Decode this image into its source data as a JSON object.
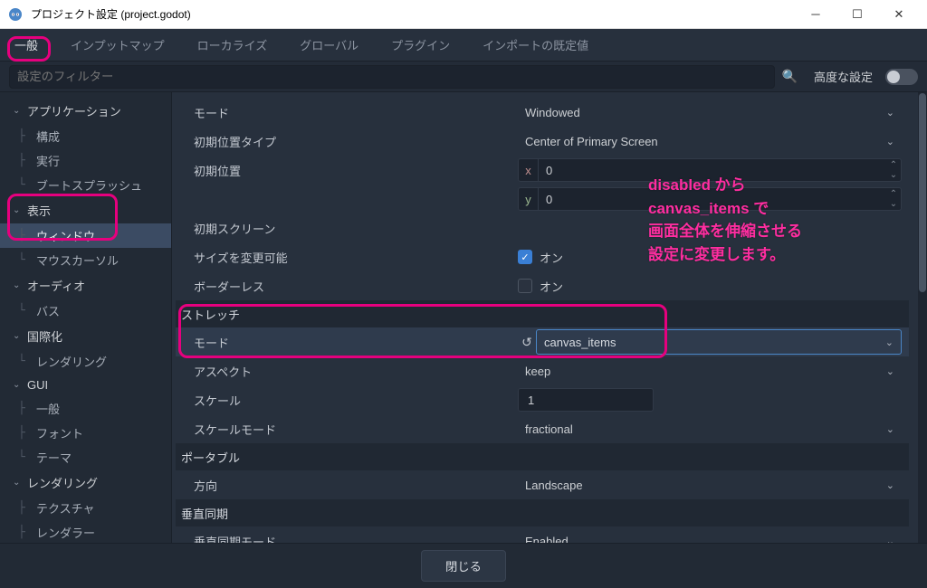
{
  "window": {
    "title": "プロジェクト設定 (project.godot)"
  },
  "tabs": {
    "general": "一般",
    "inputmap": "インプットマップ",
    "localize": "ローカライズ",
    "global": "グローバル",
    "plugin": "プラグイン",
    "import_defaults": "インポートの既定値"
  },
  "filter": {
    "placeholder": "設定のフィルター",
    "advanced_label": "高度な設定"
  },
  "sidebar": {
    "application": "アプリケーション",
    "app_config": "構成",
    "app_run": "実行",
    "app_boot": "ブートスプラッシュ",
    "display": "表示",
    "display_window": "ウィンドウ",
    "display_cursor": "マウスカーソル",
    "audio": "オーディオ",
    "audio_bus": "バス",
    "i18n": "国際化",
    "i18n_rendering": "レンダリング",
    "gui": "GUI",
    "gui_general": "一般",
    "gui_font": "フォント",
    "gui_theme": "テーマ",
    "rendering": "レンダリング",
    "rendering_tex": "テクスチャ",
    "rendering_renderer": "レンダラー"
  },
  "settings": {
    "mode_label": "モード",
    "mode_value": "Windowed",
    "initpos_type_label": "初期位置タイプ",
    "initpos_type_value": "Center of Primary Screen",
    "initpos_label": "初期位置",
    "initpos_x": "0",
    "initpos_y": "0",
    "initscreen_label": "初期スクリーン",
    "resizable_label": "サイズを変更可能",
    "on_text": "オン",
    "borderless_label": "ボーダーレス",
    "stretch_section": "ストレッチ",
    "stretch_mode_label": "モード",
    "stretch_mode_value": "canvas_items",
    "aspect_label": "アスペクト",
    "aspect_value": "keep",
    "scale_label": "スケール",
    "scale_value": "1",
    "scalemode_label": "スケールモード",
    "scalemode_value": "fractional",
    "portable_section": "ポータブル",
    "orientation_label": "方向",
    "orientation_value": "Landscape",
    "vsync_section": "垂直同期",
    "vsyncmode_label": "垂直同期モード",
    "vsyncmode_value": "Enabled"
  },
  "footer": {
    "close": "閉じる"
  },
  "annotation": {
    "line1": "disabled から",
    "line2": "canvas_items で",
    "line3": "画面全体を伸縮させる",
    "line4": "設定に変更します。"
  }
}
